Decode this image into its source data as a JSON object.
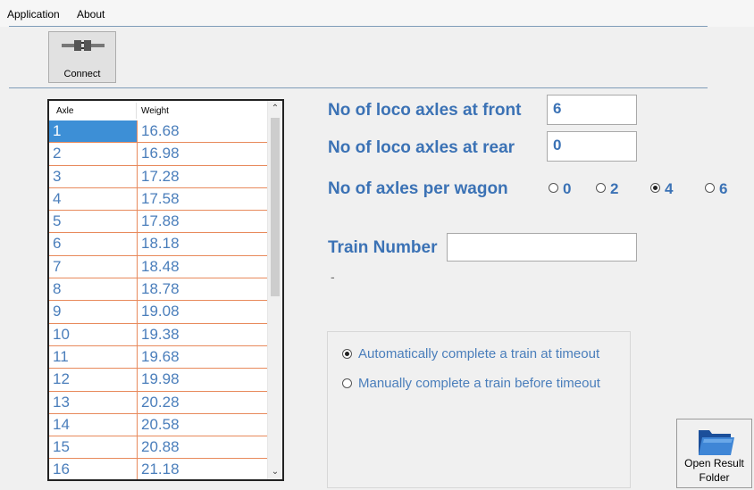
{
  "menu": {
    "application": "Application",
    "about": "About"
  },
  "toolbar": {
    "connect_label": "Connect"
  },
  "grid": {
    "headers": {
      "axle": "Axle",
      "weight": "Weight"
    },
    "rows": [
      {
        "axle": "1",
        "weight": "16.68"
      },
      {
        "axle": "2",
        "weight": "16.98"
      },
      {
        "axle": "3",
        "weight": "17.28"
      },
      {
        "axle": "4",
        "weight": "17.58"
      },
      {
        "axle": "5",
        "weight": "17.88"
      },
      {
        "axle": "6",
        "weight": "18.18"
      },
      {
        "axle": "7",
        "weight": "18.48"
      },
      {
        "axle": "8",
        "weight": "18.78"
      },
      {
        "axle": "9",
        "weight": "19.08"
      },
      {
        "axle": "10",
        "weight": "19.38"
      },
      {
        "axle": "11",
        "weight": "19.68"
      },
      {
        "axle": "12",
        "weight": "19.98"
      },
      {
        "axle": "13",
        "weight": "20.28"
      },
      {
        "axle": "14",
        "weight": "20.58"
      },
      {
        "axle": "15",
        "weight": "20.88"
      },
      {
        "axle": "16",
        "weight": "21.18"
      }
    ]
  },
  "settings": {
    "front_label": "No of loco axles at front",
    "front_value": "6",
    "rear_label": "No of loco axles at rear",
    "rear_value": "0",
    "wagon_label": "No of axles per wagon",
    "wagon_options": [
      "0",
      "2",
      "4",
      "6"
    ],
    "wagon_selected": "4",
    "train_number_label": "Train Number",
    "train_number_value": "",
    "dash_text": "-"
  },
  "completion": {
    "auto_label": "Automatically complete a train at timeout",
    "manual_label": "Manually complete a train before timeout",
    "selected": "auto"
  },
  "open_result": {
    "line1": "Open Result",
    "line2": "Folder"
  },
  "colors": {
    "accent_text": "#3b72b5",
    "grid_border": "#e88a5c",
    "selection": "#3d8fd6"
  }
}
